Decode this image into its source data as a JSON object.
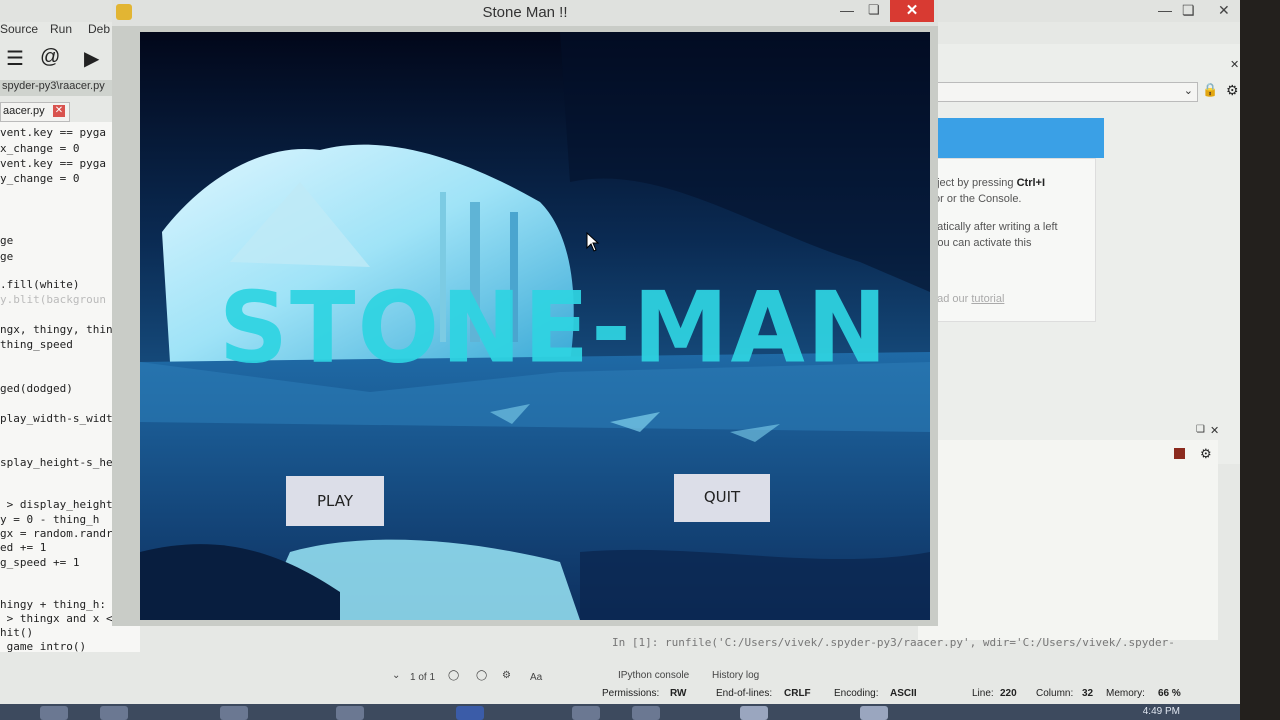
{
  "ide": {
    "menu": [
      "Source",
      "Run",
      "Deb"
    ],
    "path_tab": "spyder-py3\\raacer.py",
    "file_tab": "aacer.py",
    "code_lines": [
      "vent.key == pyga",
      "x_change = 0",
      "vent.key == pyga",
      "y_change = 0",
      "ge",
      "ge",
      ".fill(white)",
      "y.blit(backgroun",
      "ngx, thingy, thing",
      "thing_speed",
      "ged(dodged)",
      "play_width-s_width",
      "splay_height-s_heig",
      " > display_height:",
      "y = 0 - thing_h",
      "gx = random.randrang",
      "ed += 1",
      "g_speed += 1",
      "hingy + thing_h:",
      " > thingx and x < th",
      "hit()",
      " game_intro()"
    ],
    "help": {
      "line1_pre": "bject by pressing ",
      "line1_bold": "Ctrl+I",
      "line2": "tor or the Console.",
      "line3": "natically after writing a left",
      "line4": " You can activate this",
      "line5": "ead our ",
      "line5_link": "tutorial"
    },
    "console_line": "In [1]: runfile('C:/Users/vivek/.spyder-py3/raacer.py', wdir='C:/Users/vivek/.spyder-",
    "find": {
      "count": "1 of 1",
      "aa": "Aa"
    },
    "console_tabs": {
      "ipython": "IPython console",
      "history": "History log"
    },
    "status": {
      "permissions_label": "Permissions:",
      "permissions_value": "RW",
      "eol_label": "End-of-lines:",
      "eol_value": "CRLF",
      "encoding_label": "Encoding:",
      "encoding_value": "ASCII",
      "line_label": "Line:",
      "line_value": "220",
      "column_label": "Column:",
      "column_value": "32",
      "memory_label": "Memory:",
      "memory_value": "66 %"
    },
    "clock": "4:49 PM"
  },
  "game": {
    "window_title": "Stone Man !!",
    "title_text": "STONE-MAN",
    "play_label": "PLAY",
    "quit_label": "QUIT",
    "title_color": "#2fd4e2"
  }
}
